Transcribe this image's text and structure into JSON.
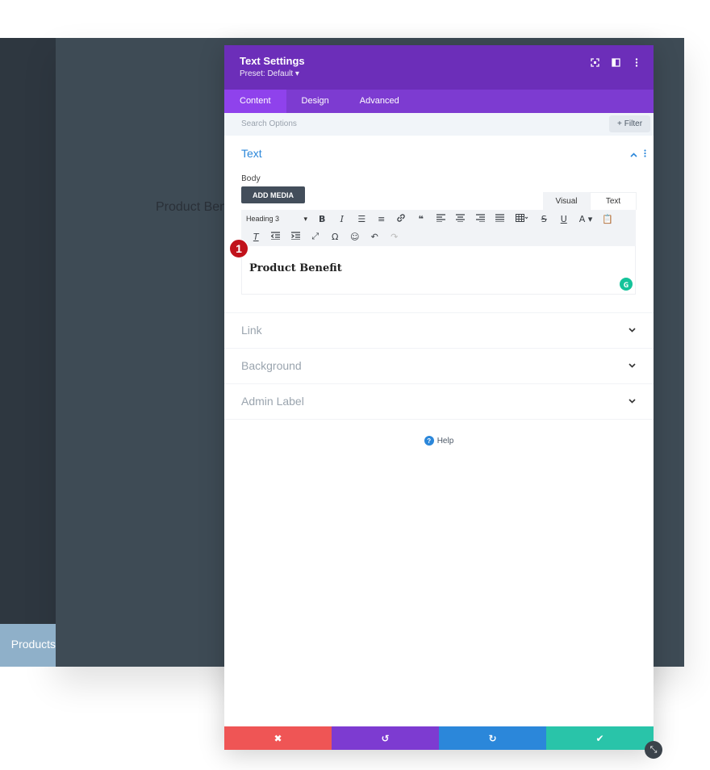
{
  "background": {
    "preview_text": "Product Benefit",
    "sidebar_button": "Products"
  },
  "modal": {
    "title": "Text Settings",
    "preset": "Preset: Default ▾",
    "tabs": [
      {
        "label": "Content"
      },
      {
        "label": "Design"
      },
      {
        "label": "Advanced"
      }
    ],
    "search_placeholder": "Search Options",
    "filter_label": "Filter",
    "text_section": {
      "title": "Text",
      "body_label": "Body",
      "add_media": "ADD MEDIA",
      "editor_tabs": {
        "visual": "Visual",
        "text": "Text"
      },
      "format_select": "Heading 3",
      "content": "Product Benefit"
    },
    "sections": [
      {
        "title": "Link"
      },
      {
        "title": "Background"
      },
      {
        "title": "Admin Label"
      }
    ],
    "help": "Help"
  },
  "annotation": {
    "number": "1"
  },
  "colors": {
    "header": "#6c2eb9",
    "tabs": "#7d3bd1",
    "active_tab": "#8f42ec",
    "accent": "#2b87da",
    "cancel": "#ef5555",
    "save": "#29c4a9"
  }
}
